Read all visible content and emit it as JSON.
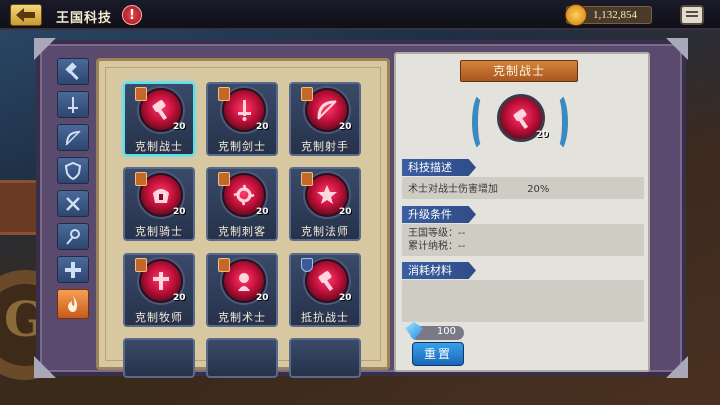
{
  "header": {
    "title": "王国科技",
    "help_symbol": "!",
    "coins": "1,132,854"
  },
  "tabs": [
    {
      "icon": "hammer-icon",
      "active": false
    },
    {
      "icon": "sword-icon",
      "active": false
    },
    {
      "icon": "bow-icon",
      "active": false
    },
    {
      "icon": "shield-icon",
      "active": false
    },
    {
      "icon": "dagger-icon",
      "active": false
    },
    {
      "icon": "staff-icon",
      "active": false
    },
    {
      "icon": "cross-icon",
      "active": false
    },
    {
      "icon": "flame-icon",
      "active": true
    }
  ],
  "grid": {
    "cells": [
      {
        "label": "克制战士",
        "level": "20",
        "badge": "sword",
        "selected": true
      },
      {
        "label": "克制剑士",
        "level": "20",
        "badge": "sword"
      },
      {
        "label": "克制射手",
        "level": "20",
        "badge": "sword"
      },
      {
        "label": "克制骑士",
        "level": "20",
        "badge": "sword"
      },
      {
        "label": "克制刺客",
        "level": "20",
        "badge": "sword"
      },
      {
        "label": "克制法师",
        "level": "20",
        "badge": "sword"
      },
      {
        "label": "克制牧师",
        "level": "20",
        "badge": "sword"
      },
      {
        "label": "克制术士",
        "level": "20",
        "badge": "sword"
      },
      {
        "label": "抵抗战士",
        "level": "20",
        "badge": "shield"
      }
    ]
  },
  "detail": {
    "title": "克制战士",
    "level": "20",
    "desc_header": "科技描述",
    "desc_text": "术士对战士伤害增加",
    "desc_value": "20%",
    "upgrade_header": "升级条件",
    "upgrade_kingdom": "王国等级：--",
    "upgrade_tax": "累计纳税：--",
    "cost_header": "消耗材料",
    "gem_cost": "100",
    "reset_label": "重置"
  },
  "colors": {
    "accent_blue": "#3a5ea0",
    "icon_red": "#c0103a",
    "selected_border": "#5ae0f0"
  }
}
